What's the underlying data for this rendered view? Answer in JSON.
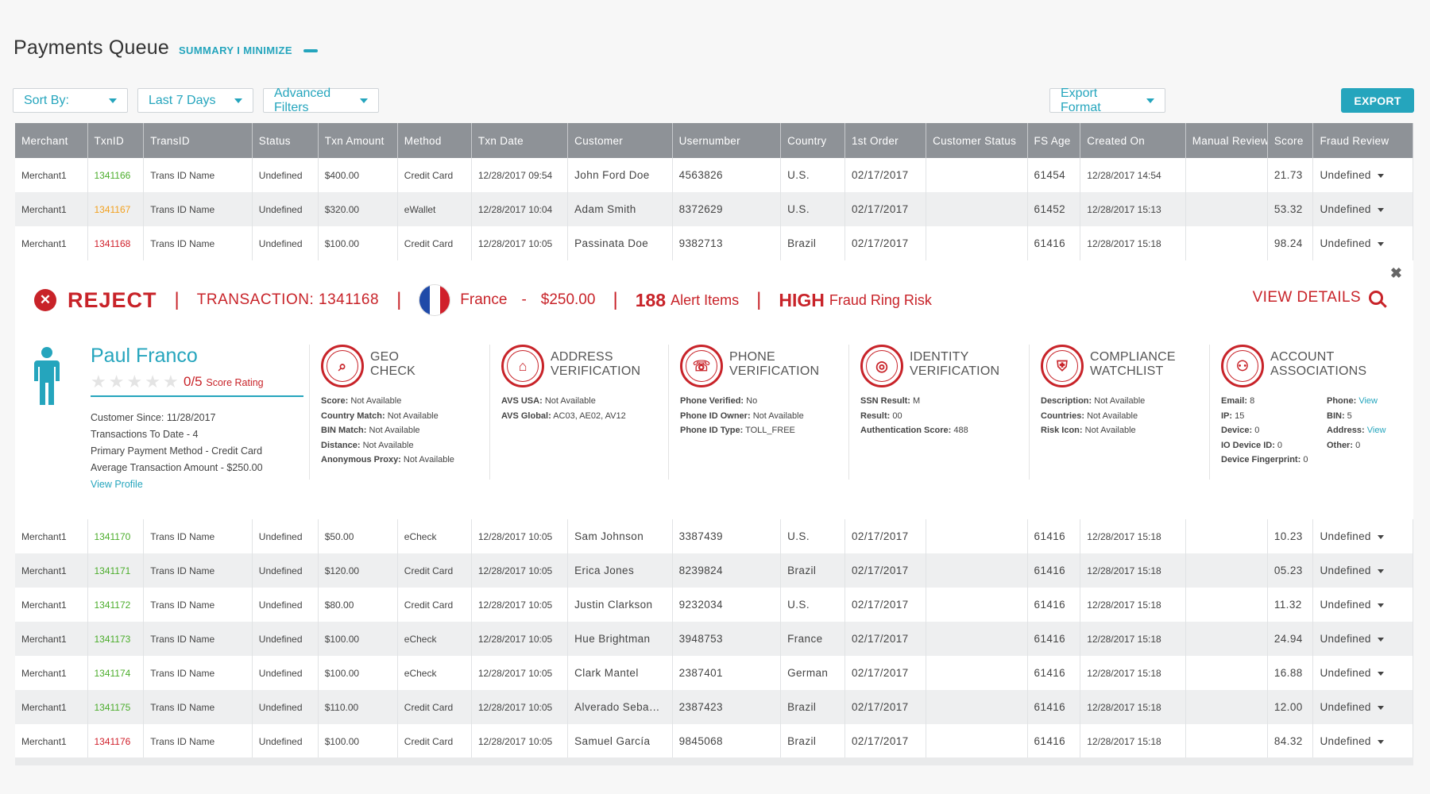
{
  "header": {
    "title": "Payments Queue",
    "links": "SUMMARY I MINIMIZE"
  },
  "toolbar": {
    "sort_by": "Sort By:",
    "date_range": "Last 7 Days",
    "advanced_filters": "Advanced Filters",
    "export_format": "Export Format",
    "export": "EXPORT"
  },
  "table": {
    "columns": [
      "Merchant",
      "TxnID",
      "TransID",
      "Status",
      "Txn Amount",
      "Method",
      "Txn Date",
      "Customer",
      "Usernumber",
      "Country",
      "1st Order",
      "Customer Status",
      "FS Age",
      "Created On",
      "Manual Review",
      "Score",
      "Fraud Review"
    ],
    "rows_top": [
      {
        "merchant": "Merchant1",
        "txnid": "1341166",
        "transid": "Trans ID Name",
        "status": "Undefined",
        "amount": "$400.00",
        "method": "Credit Card",
        "txn_date": "12/28/2017 09:54",
        "customer": "John Ford Doe",
        "usernumber": "4563826",
        "country": "U.S.",
        "first_order": "02/17/2017",
        "customer_status": "",
        "fs_age": "61454",
        "created_on": "12/28/2017 14:54",
        "manual_review": "",
        "score": "21.73",
        "fraud_review": "Undefined",
        "color": "green"
      },
      {
        "merchant": "Merchant1",
        "txnid": "1341167",
        "transid": "Trans ID Name",
        "status": "Undefined",
        "amount": "$320.00",
        "method": "eWallet",
        "txn_date": "12/28/2017 10:04",
        "customer": "Adam Smith",
        "usernumber": "8372629",
        "country": "U.S.",
        "first_order": "02/17/2017",
        "customer_status": "",
        "fs_age": "61452",
        "created_on": "12/28/2017 15:13",
        "manual_review": "",
        "score": "53.32",
        "fraud_review": "Undefined",
        "color": "orange"
      },
      {
        "merchant": "Merchant1",
        "txnid": "1341168",
        "transid": "Trans ID Name",
        "status": "Undefined",
        "amount": "$100.00",
        "method": "Credit Card",
        "txn_date": "12/28/2017 10:05",
        "customer": "Passinata Doe",
        "usernumber": "9382713",
        "country": "Brazil",
        "first_order": "02/17/2017",
        "customer_status": "",
        "fs_age": "61416",
        "created_on": "12/28/2017 15:18",
        "manual_review": "",
        "score": "98.24",
        "fraud_review": "Undefined",
        "color": "red"
      }
    ],
    "rows_bottom": [
      {
        "merchant": "Merchant1",
        "txnid": "1341170",
        "transid": "Trans ID Name",
        "status": "Undefined",
        "amount": "$50.00",
        "method": "eCheck",
        "txn_date": "12/28/2017 10:05",
        "customer": "Sam Johnson",
        "usernumber": "3387439",
        "country": "U.S.",
        "first_order": "02/17/2017",
        "customer_status": "",
        "fs_age": "61416",
        "created_on": "12/28/2017 15:18",
        "manual_review": "",
        "score": "10.23",
        "fraud_review": "Undefined",
        "color": "green"
      },
      {
        "merchant": "Merchant1",
        "txnid": "1341171",
        "transid": "Trans ID Name",
        "status": "Undefined",
        "amount": "$120.00",
        "method": "Credit Card",
        "txn_date": "12/28/2017 10:05",
        "customer": "Erica Jones",
        "usernumber": "8239824",
        "country": "Brazil",
        "first_order": "02/17/2017",
        "customer_status": "",
        "fs_age": "61416",
        "created_on": "12/28/2017 15:18",
        "manual_review": "",
        "score": "05.23",
        "fraud_review": "Undefined",
        "color": "green"
      },
      {
        "merchant": "Merchant1",
        "txnid": "1341172",
        "transid": "Trans ID Name",
        "status": "Undefined",
        "amount": "$80.00",
        "method": "Credit Card",
        "txn_date": "12/28/2017 10:05",
        "customer": "Justin Clarkson",
        "usernumber": "9232034",
        "country": "U.S.",
        "first_order": "02/17/2017",
        "customer_status": "",
        "fs_age": "61416",
        "created_on": "12/28/2017 15:18",
        "manual_review": "",
        "score": "11.32",
        "fraud_review": "Undefined",
        "color": "green"
      },
      {
        "merchant": "Merchant1",
        "txnid": "1341173",
        "transid": "Trans ID Name",
        "status": "Undefined",
        "amount": "$100.00",
        "method": "eCheck",
        "txn_date": "12/28/2017 10:05",
        "customer": "Hue Brightman",
        "usernumber": "3948753",
        "country": "France",
        "first_order": "02/17/2017",
        "customer_status": "",
        "fs_age": "61416",
        "created_on": "12/28/2017 15:18",
        "manual_review": "",
        "score": "24.94",
        "fraud_review": "Undefined",
        "color": "green"
      },
      {
        "merchant": "Merchant1",
        "txnid": "1341174",
        "transid": "Trans ID Name",
        "status": "Undefined",
        "amount": "$100.00",
        "method": "eCheck",
        "txn_date": "12/28/2017 10:05",
        "customer": "Clark Mantel",
        "usernumber": "2387401",
        "country": "German",
        "first_order": "02/17/2017",
        "customer_status": "",
        "fs_age": "61416",
        "created_on": "12/28/2017 15:18",
        "manual_review": "",
        "score": "16.88",
        "fraud_review": "Undefined",
        "color": "green"
      },
      {
        "merchant": "Merchant1",
        "txnid": "1341175",
        "transid": "Trans ID Name",
        "status": "Undefined",
        "amount": "$110.00",
        "method": "Credit Card",
        "txn_date": "12/28/2017 10:05",
        "customer": "Alverado Seba…",
        "usernumber": "2387423",
        "country": "Brazil",
        "first_order": "02/17/2017",
        "customer_status": "",
        "fs_age": "61416",
        "created_on": "12/28/2017 15:18",
        "manual_review": "",
        "score": "12.00",
        "fraud_review": "Undefined",
        "color": "green"
      },
      {
        "merchant": "Merchant1",
        "txnid": "1341176",
        "transid": "Trans ID Name",
        "status": "Undefined",
        "amount": "$100.00",
        "method": "Credit Card",
        "txn_date": "12/28/2017 10:05",
        "customer": "Samuel García",
        "usernumber": "9845068",
        "country": "Brazil",
        "first_order": "02/17/2017",
        "customer_status": "",
        "fs_age": "61416",
        "created_on": "12/28/2017 15:18",
        "manual_review": "",
        "score": "84.32",
        "fraud_review": "Undefined",
        "color": "red"
      }
    ]
  },
  "detail": {
    "decision": "REJECT",
    "transaction_label": "TRANSACTION:",
    "transaction_id": "1341168",
    "country": "France",
    "dash": "-",
    "amount": "$250.00",
    "alert_count": "188",
    "alert_label": "Alert Items",
    "risk_level": "HIGH",
    "risk_label": "Fraud Ring Risk",
    "view_details": "VIEW DETAILS",
    "flag_colors": [
      "#1f4aa8",
      "#ffffff",
      "#d0202b"
    ],
    "profile": {
      "name": "Paul Franco",
      "score": "0/5",
      "score_label": "Score Rating",
      "customer_since": "Customer Since: 11/28/2017",
      "transactions": "Transactions To Date - 4",
      "payment_method": "Primary Payment Method - Credit Card",
      "avg_amount": "Average Transaction Amount - $250.00",
      "view_profile": "View Profile"
    },
    "checks": {
      "geo": {
        "title1": "GEO",
        "title2": "CHECK",
        "lines": [
          {
            "k": "Score:",
            "v": "Not Available"
          },
          {
            "k": "Country Match:",
            "v": "Not Available"
          },
          {
            "k": "BIN Match:",
            "v": "Not Available"
          },
          {
            "k": "Distance:",
            "v": "Not Available"
          },
          {
            "k": "Anonymous Proxy:",
            "v": "Not Available"
          }
        ]
      },
      "address": {
        "title1": "ADDRESS",
        "title2": "VERIFICATION",
        "lines": [
          {
            "k": "AVS USA:",
            "v": "Not Available"
          },
          {
            "k": "AVS Global:",
            "v": "AC03, AE02, AV12"
          }
        ]
      },
      "phone": {
        "title1": "PHONE",
        "title2": "VERIFICATION",
        "lines": [
          {
            "k": "Phone Verified:",
            "v": "No"
          },
          {
            "k": "Phone ID Owner:",
            "v": "Not Available"
          },
          {
            "k": "Phone ID Type:",
            "v": "TOLL_FREE"
          }
        ]
      },
      "identity": {
        "title1": "IDENTITY",
        "title2": "VERIFICATION",
        "lines": [
          {
            "k": "SSN Result:",
            "v": "M"
          },
          {
            "k": "Result:",
            "v": "00"
          },
          {
            "k": "Authentication Score:",
            "v": "488"
          }
        ]
      },
      "compliance": {
        "title1": "COMPLIANCE",
        "title2": "WATCHLIST",
        "lines": [
          {
            "k": "Description:",
            "v": "Not Available"
          },
          {
            "k": "Countries:",
            "v": "Not Available"
          },
          {
            "k": "Risk Icon:",
            "v": "Not Available"
          }
        ]
      },
      "account": {
        "title1": "ACCOUNT",
        "title2": "ASSOCIATIONS",
        "left": [
          {
            "k": "Email:",
            "v": "8"
          },
          {
            "k": "IP:",
            "v": "15"
          },
          {
            "k": "Device:",
            "v": "0"
          },
          {
            "k": "IO Device ID:",
            "v": "0"
          },
          {
            "k": "Device Fingerprint:",
            "v": "0"
          }
        ],
        "right": [
          {
            "k": "Phone:",
            "v": "View"
          },
          {
            "k": "BIN:",
            "v": "5"
          },
          {
            "k": "Address:",
            "v": "View"
          },
          {
            "k": "Other:",
            "v": "0"
          }
        ]
      }
    }
  },
  "colors": {
    "accent": "#25a5bd",
    "reject_red": "#c82329",
    "header_gray": "#8e9297",
    "score_green": "#4bad2b",
    "score_orange": "#f2a11f",
    "score_red": "#d0202b"
  }
}
